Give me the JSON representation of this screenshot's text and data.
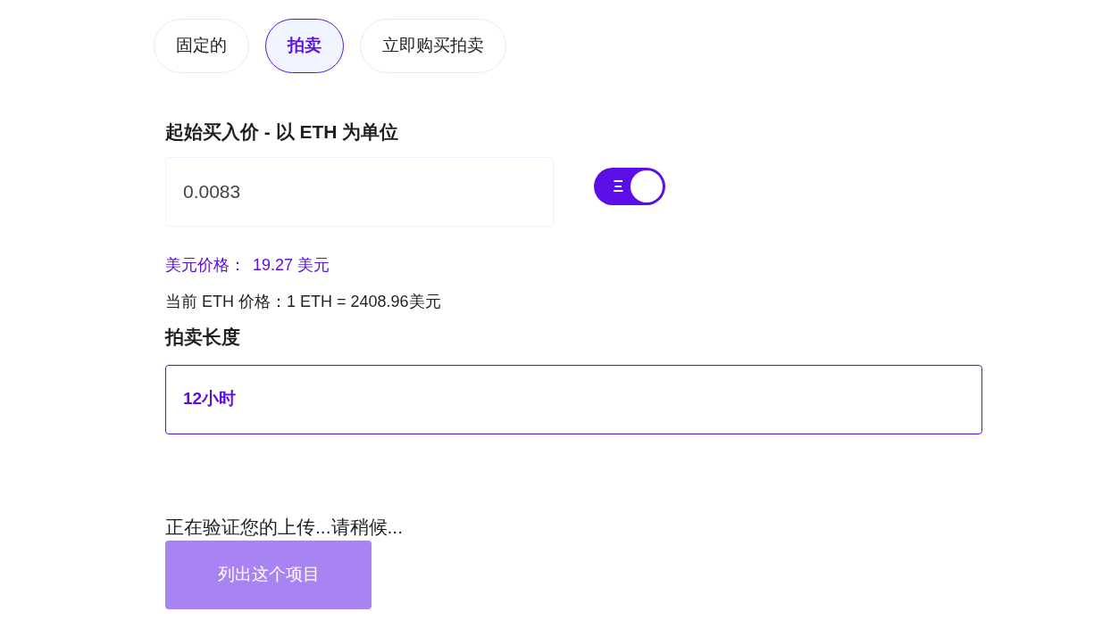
{
  "tabs": [
    {
      "label": "固定的",
      "selected": false
    },
    {
      "label": "拍卖",
      "selected": true
    },
    {
      "label": "立即购买拍卖",
      "selected": false
    }
  ],
  "start_price": {
    "label": "起始买入价 - 以 ETH 为单位",
    "value": "0.0083",
    "currency_toggle": {
      "on": true,
      "symbol": "Ξ"
    }
  },
  "usd_price": {
    "label": "美元价格：",
    "value": "19.27 美元"
  },
  "eth_rate": "当前 ETH 价格：1 ETH = 2408.96美元",
  "auction_length": {
    "label": "拍卖长度",
    "value": "12小时"
  },
  "status": "正在验证您的上传...请稍候...",
  "submit_button": {
    "label": "列出这个项目",
    "disabled": true
  }
}
